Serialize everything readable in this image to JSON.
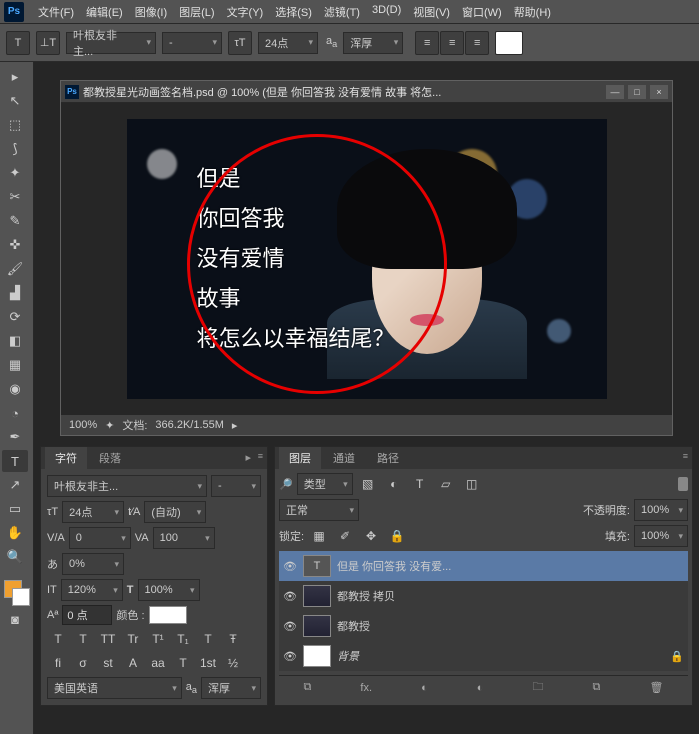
{
  "menu": [
    "文件(F)",
    "编辑(E)",
    "图像(I)",
    "图层(L)",
    "文字(Y)",
    "选择(S)",
    "滤镜(T)",
    "3D(D)",
    "视图(V)",
    "窗口(W)",
    "帮助(H)"
  ],
  "options": {
    "font": "叶根友非主...",
    "size": "24点",
    "aa": "浑厚"
  },
  "doc": {
    "title": "都教授星光动画签名档.psd @ 100% (但是 你回答我 没有爱情 故事 将怎...",
    "zoom": "100%",
    "info_label": "文档:",
    "info": "366.2K/1.55M",
    "lines": [
      "但是",
      "你回答我",
      "没有爱情",
      "故事",
      "将怎么以幸福结尾？"
    ]
  },
  "char": {
    "tab1": "字符",
    "tab2": "段落",
    "font": "叶根友非主...",
    "style": "-",
    "size": "24点",
    "leading": "(自动)",
    "tracking": "0",
    "kerning": "100",
    "baseline": "0%",
    "vscale": "120%",
    "hscale": "100%",
    "bl_shift": "0 点",
    "color_label": "颜色 :",
    "btns": [
      "T",
      "T",
      "TT",
      "Tr",
      "T¹",
      "T₁",
      "T",
      "Ŧ"
    ],
    "ot": [
      "fi",
      "σ",
      "st",
      "A",
      "aa",
      "T",
      "1st",
      "½"
    ],
    "lang": "美国英语",
    "aa": "浑厚"
  },
  "layers": {
    "tab1": "图层",
    "tab2": "通道",
    "tab3": "路径",
    "kind": "类型",
    "blend": "正常",
    "op_label": "不透明度:",
    "opacity": "100%",
    "lock_label": "锁定:",
    "fill_label": "填充:",
    "fill": "100%",
    "rows": [
      {
        "name": "但是 你回答我 没有爱...",
        "type": "T",
        "active": true
      },
      {
        "name": "都教授 拷贝",
        "type": "img"
      },
      {
        "name": "都教授",
        "type": "img"
      },
      {
        "name": "背景",
        "type": "bg",
        "lock": true
      }
    ]
  },
  "icons": {
    "min": "—",
    "max": "□",
    "close": "×",
    "menu": "≡",
    "chev": "▸",
    "aa": "aa",
    "lock": "🔒",
    "eye": "👁",
    "link": "⧉",
    "fx": "fx.",
    "mask": "◐",
    "folder": "🗀",
    "new": "⧉",
    "trash": "🗑"
  }
}
